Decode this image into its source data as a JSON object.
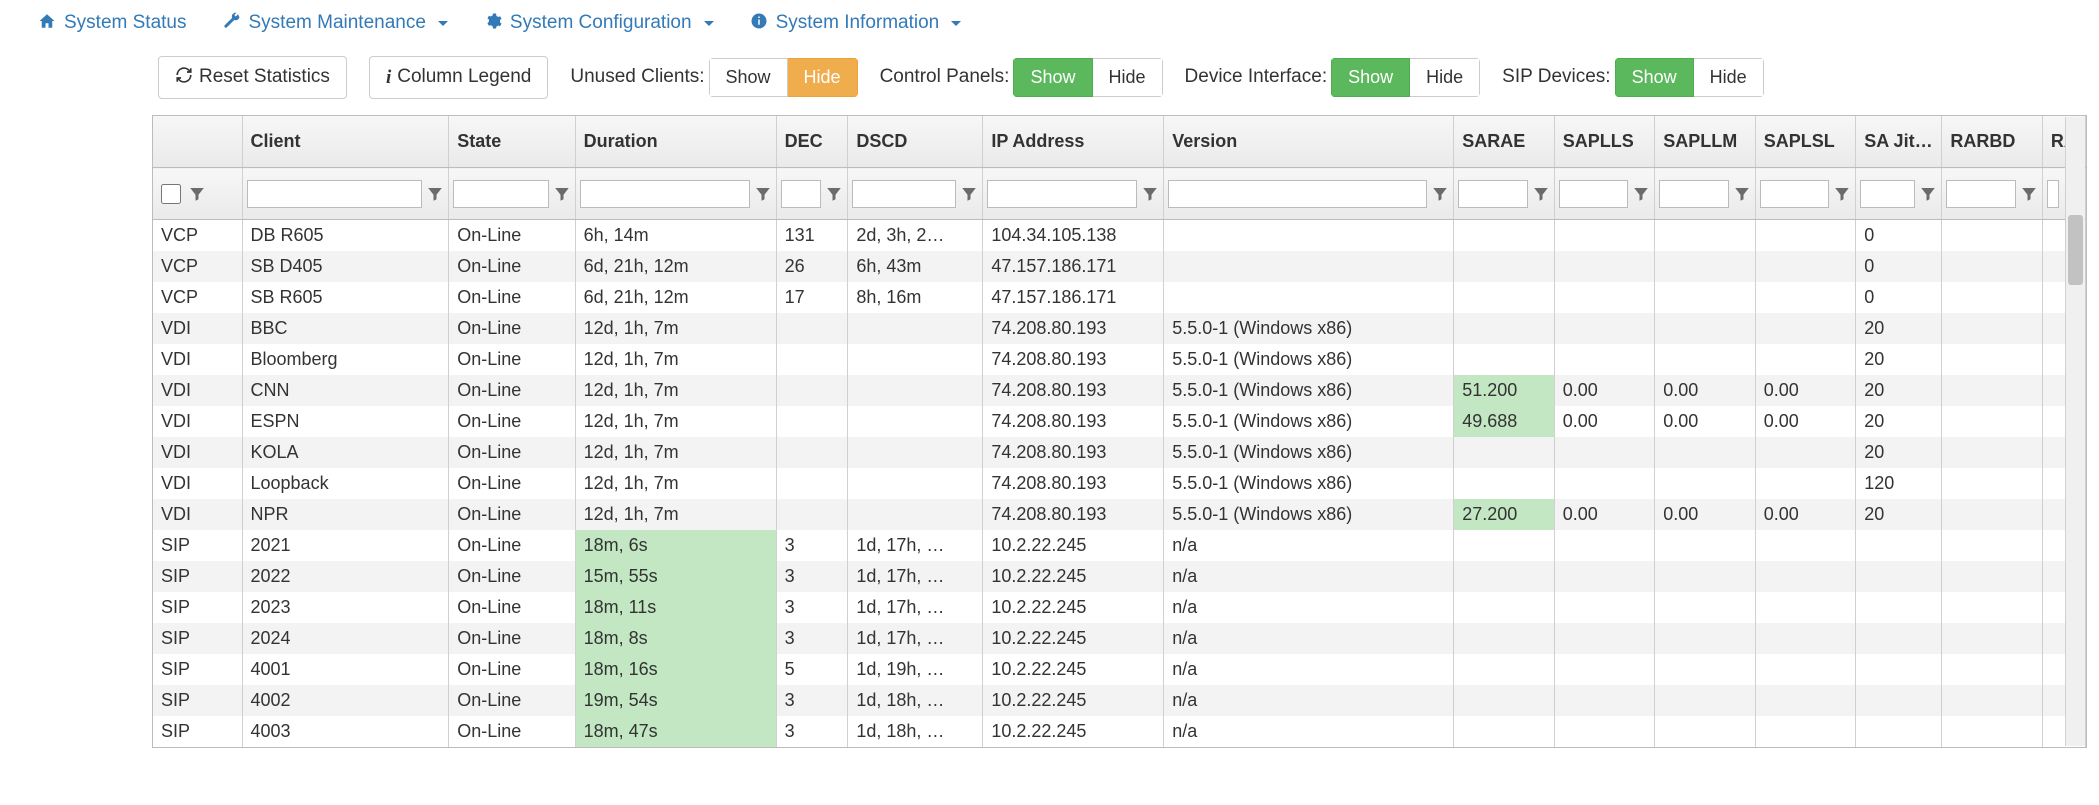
{
  "nav": {
    "status": "System Status",
    "maintenance": "System Maintenance",
    "configuration": "System Configuration",
    "information": "System Information"
  },
  "toolbar": {
    "reset": "Reset Statistics",
    "legend": "Column Legend",
    "unused_label": "Unused Clients:",
    "control_label": "Control Panels:",
    "device_label": "Device Interface:",
    "sip_label": "SIP Devices:",
    "show": "Show",
    "hide": "Hide"
  },
  "columns": {
    "c0": "",
    "c1": "Client",
    "c2": "State",
    "c3": "Duration",
    "c4": "DEC",
    "c5": "DSCD",
    "c6": "IP Address",
    "c7": "Version",
    "c8": "SARAE",
    "c9": "SAPLLS",
    "c10": "SAPLLM",
    "c11": "SAPLSL",
    "c12": "SA Jitter",
    "c13": "RARBD",
    "c14": "RA"
  },
  "rows": [
    {
      "c0": "VCP",
      "c1": "DB R605",
      "c2": "On-Line",
      "c3": "6h, 14m",
      "c4": "131",
      "c5": "2d, 3h, 2…",
      "c6": "104.34.105.138",
      "c7": "",
      "c8": "",
      "c9": "",
      "c10": "",
      "c11": "",
      "c12": "0",
      "c13": ""
    },
    {
      "c0": "VCP",
      "c1": "SB D405",
      "c2": "On-Line",
      "c3": "6d, 21h, 12m",
      "c4": "26",
      "c5": "6h, 43m",
      "c6": "47.157.186.171",
      "c7": "",
      "c8": "",
      "c9": "",
      "c10": "",
      "c11": "",
      "c12": "0",
      "c13": ""
    },
    {
      "c0": "VCP",
      "c1": "SB R605",
      "c2": "On-Line",
      "c3": "6d, 21h, 12m",
      "c4": "17",
      "c5": "8h, 16m",
      "c6": "47.157.186.171",
      "c7": "",
      "c8": "",
      "c9": "",
      "c10": "",
      "c11": "",
      "c12": "0",
      "c13": ""
    },
    {
      "c0": "VDI",
      "c1": "BBC",
      "c2": "On-Line",
      "c3": "12d, 1h, 7m",
      "c4": "",
      "c5": "",
      "c6": "74.208.80.193",
      "c7": "5.5.0-1 (Windows x86)",
      "c8": "",
      "c9": "",
      "c10": "",
      "c11": "",
      "c12": "20",
      "c13": ""
    },
    {
      "c0": "VDI",
      "c1": "Bloomberg",
      "c2": "On-Line",
      "c3": "12d, 1h, 7m",
      "c4": "",
      "c5": "",
      "c6": "74.208.80.193",
      "c7": "5.5.0-1 (Windows x86)",
      "c8": "",
      "c9": "",
      "c10": "",
      "c11": "",
      "c12": "20",
      "c13": ""
    },
    {
      "c0": "VDI",
      "c1": "CNN",
      "c2": "On-Line",
      "c3": "12d, 1h, 7m",
      "c4": "",
      "c5": "",
      "c6": "74.208.80.193",
      "c7": "5.5.0-1 (Windows x86)",
      "c8": "51.200",
      "c8hl": true,
      "c9": "0.00",
      "c10": "0.00",
      "c11": "0.00",
      "c12": "20",
      "c13": ""
    },
    {
      "c0": "VDI",
      "c1": "ESPN",
      "c2": "On-Line",
      "c3": "12d, 1h, 7m",
      "c4": "",
      "c5": "",
      "c6": "74.208.80.193",
      "c7": "5.5.0-1 (Windows x86)",
      "c8": "49.688",
      "c8hl": true,
      "c9": "0.00",
      "c10": "0.00",
      "c11": "0.00",
      "c12": "20",
      "c13": ""
    },
    {
      "c0": "VDI",
      "c1": "KOLA",
      "c2": "On-Line",
      "c3": "12d, 1h, 7m",
      "c4": "",
      "c5": "",
      "c6": "74.208.80.193",
      "c7": "5.5.0-1 (Windows x86)",
      "c8": "",
      "c9": "",
      "c10": "",
      "c11": "",
      "c12": "20",
      "c13": ""
    },
    {
      "c0": "VDI",
      "c1": "Loopback",
      "c2": "On-Line",
      "c3": "12d, 1h, 7m",
      "c4": "",
      "c5": "",
      "c6": "74.208.80.193",
      "c7": "5.5.0-1 (Windows x86)",
      "c8": "",
      "c9": "",
      "c10": "",
      "c11": "",
      "c12": "120",
      "c13": ""
    },
    {
      "c0": "VDI",
      "c1": "NPR",
      "c2": "On-Line",
      "c3": "12d, 1h, 7m",
      "c4": "",
      "c5": "",
      "c6": "74.208.80.193",
      "c7": "5.5.0-1 (Windows x86)",
      "c8": "27.200",
      "c8hl": true,
      "c9": "0.00",
      "c10": "0.00",
      "c11": "0.00",
      "c12": "20",
      "c13": ""
    },
    {
      "c0": "SIP",
      "c1": "2021",
      "c2": "On-Line",
      "c3": "18m, 6s",
      "c3hl": true,
      "c4": "3",
      "c5": "1d, 17h, …",
      "c6": "10.2.22.245",
      "c7": "n/a",
      "c8": "",
      "c9": "",
      "c10": "",
      "c11": "",
      "c12": "",
      "c13": ""
    },
    {
      "c0": "SIP",
      "c1": "2022",
      "c2": "On-Line",
      "c3": "15m, 55s",
      "c3hl": true,
      "c4": "3",
      "c5": "1d, 17h, …",
      "c6": "10.2.22.245",
      "c7": "n/a",
      "c8": "",
      "c9": "",
      "c10": "",
      "c11": "",
      "c12": "",
      "c13": ""
    },
    {
      "c0": "SIP",
      "c1": "2023",
      "c2": "On-Line",
      "c3": "18m, 11s",
      "c3hl": true,
      "c4": "3",
      "c5": "1d, 17h, …",
      "c6": "10.2.22.245",
      "c7": "n/a",
      "c8": "",
      "c9": "",
      "c10": "",
      "c11": "",
      "c12": "",
      "c13": ""
    },
    {
      "c0": "SIP",
      "c1": "2024",
      "c2": "On-Line",
      "c3": "18m, 8s",
      "c3hl": true,
      "c4": "3",
      "c5": "1d, 17h, …",
      "c6": "10.2.22.245",
      "c7": "n/a",
      "c8": "",
      "c9": "",
      "c10": "",
      "c11": "",
      "c12": "",
      "c13": ""
    },
    {
      "c0": "SIP",
      "c1": "4001",
      "c2": "On-Line",
      "c3": "18m, 16s",
      "c3hl": true,
      "c4": "5",
      "c5": "1d, 19h, …",
      "c6": "10.2.22.245",
      "c7": "n/a",
      "c8": "",
      "c9": "",
      "c10": "",
      "c11": "",
      "c12": "",
      "c13": ""
    },
    {
      "c0": "SIP",
      "c1": "4002",
      "c2": "On-Line",
      "c3": "19m, 54s",
      "c3hl": true,
      "c4": "3",
      "c5": "1d, 18h, …",
      "c6": "10.2.22.245",
      "c7": "n/a",
      "c8": "",
      "c9": "",
      "c10": "",
      "c11": "",
      "c12": "",
      "c13": ""
    },
    {
      "c0": "SIP",
      "c1": "4003",
      "c2": "On-Line",
      "c3": "18m, 47s",
      "c3hl": true,
      "c4": "3",
      "c5": "1d, 18h, …",
      "c6": "10.2.22.245",
      "c7": "n/a",
      "c8": "",
      "c9": "",
      "c10": "",
      "c11": "",
      "c12": "",
      "c13": ""
    }
  ],
  "col_widths": {
    "c0": "62",
    "c1": "144",
    "c2": "88",
    "c3": "140",
    "c4": "50",
    "c5": "94",
    "c6": "126",
    "c7": "202",
    "c8": "70",
    "c9": "70",
    "c10": "70",
    "c11": "70",
    "c12": "60",
    "c13": "70",
    "c14": "30"
  }
}
